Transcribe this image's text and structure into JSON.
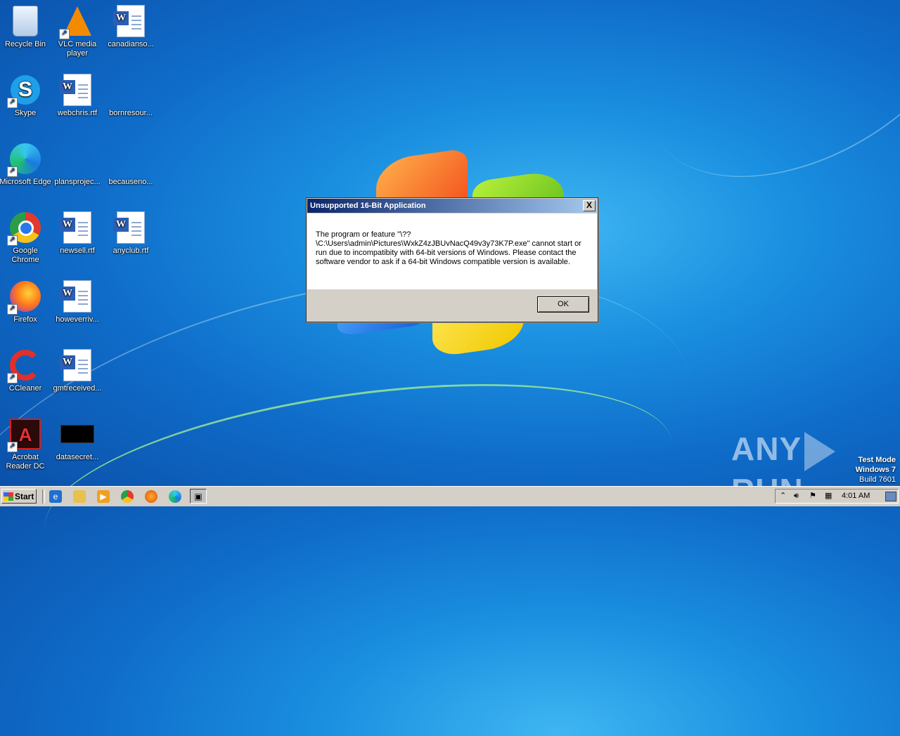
{
  "desktop": {
    "icons": [
      {
        "label": "Recycle Bin"
      },
      {
        "label": "VLC media player"
      },
      {
        "label": "canadianso..."
      },
      {
        "label": "Skype"
      },
      {
        "label": "webchris.rtf"
      },
      {
        "label": "bornresour..."
      },
      {
        "label": "Microsoft Edge"
      },
      {
        "label": "plansprojec..."
      },
      {
        "label": "becauseno..."
      },
      {
        "label": "Google Chrome"
      },
      {
        "label": "newsell.rtf"
      },
      {
        "label": "anyclub.rtf"
      },
      {
        "label": "Firefox"
      },
      {
        "label": "howeverriv..."
      },
      {
        "label": "CCleaner"
      },
      {
        "label": "gmtreceived..."
      },
      {
        "label": "Acrobat Reader DC"
      },
      {
        "label": "datasecret..."
      }
    ]
  },
  "dialog": {
    "title": "Unsupported 16-Bit Application",
    "close_label": "X",
    "message": "The program or feature \"\\??\\C:\\Users\\admin\\Pictures\\WxkZ4zJBUvNacQ49v3y73K7P.exe\" cannot start or run due to incompatibity with 64-bit versions of Windows. Please contact the software vendor to ask if a 64-bit Windows compatible version is available.",
    "ok_label": "OK"
  },
  "watermark": {
    "brand_left": "ANY",
    "brand_right": "RUN",
    "line1": "Test Mode",
    "line2": "Windows 7",
    "line3": "Build 7601"
  },
  "taskbar": {
    "start_label": "Start",
    "clock": "4:01 AM"
  }
}
